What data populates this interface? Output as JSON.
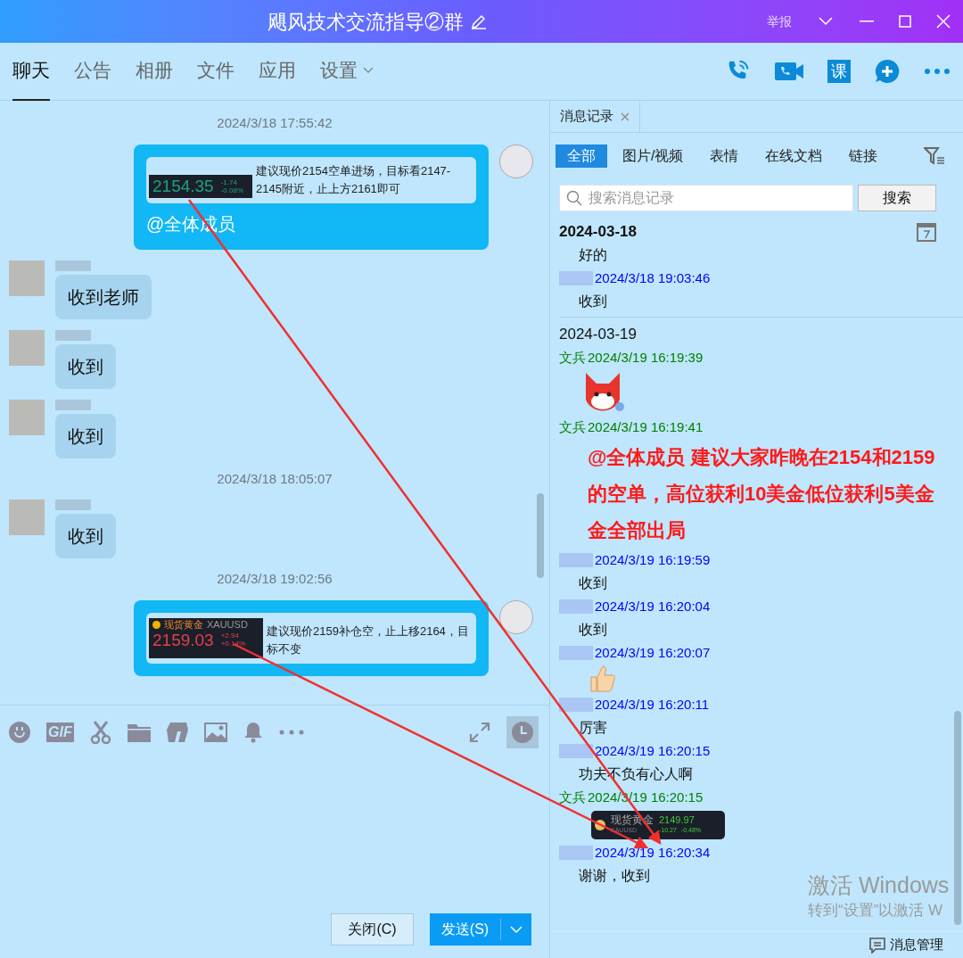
{
  "window": {
    "title": "飓风技术交流指导②群",
    "report": "举报"
  },
  "tabs": [
    {
      "label": "聊天",
      "selected": true,
      "dropdown": false
    },
    {
      "label": "公告",
      "selected": false,
      "dropdown": false
    },
    {
      "label": "相册",
      "selected": false,
      "dropdown": false
    },
    {
      "label": "文件",
      "selected": false,
      "dropdown": false
    },
    {
      "label": "应用",
      "selected": false,
      "dropdown": false
    },
    {
      "label": "设置",
      "selected": false,
      "dropdown": true
    }
  ],
  "header_actions": [
    {
      "kind": "phone"
    },
    {
      "kind": "video"
    },
    {
      "kind": "course",
      "label": "课"
    },
    {
      "kind": "add"
    },
    {
      "kind": "more"
    }
  ],
  "chat": [
    {
      "kind": "time",
      "text": "2024/3/18 17:55:42"
    },
    {
      "kind": "own",
      "quote": {
        "kind": "price",
        "price": "2154.35",
        "change": "-1.74",
        "percent": "-0.08%",
        "up": false
      },
      "text": "建议现价2154空单进场，目标看2147-2145附近，止上方2161即可",
      "mention": "@全体成员"
    },
    {
      "kind": "other",
      "text": "收到老师"
    },
    {
      "kind": "other",
      "text": "收到"
    },
    {
      "kind": "other",
      "text": "收到"
    },
    {
      "kind": "time",
      "text": "2024/3/18 18:05:07"
    },
    {
      "kind": "other",
      "text": "收到"
    },
    {
      "kind": "time",
      "text": "2024/3/18 19:02:56"
    },
    {
      "kind": "own",
      "quote": {
        "kind": "gold",
        "name": "现货黄金",
        "symbol": "XAUUSD",
        "price": "2159.03",
        "change": "+2.94",
        "percent": "+0.14%",
        "up": true
      },
      "text": "建议现价2159补仓空，止上移2164，目标不变"
    }
  ],
  "toolbar": [
    {
      "kind": "emoji"
    },
    {
      "kind": "gif",
      "label": "GIF"
    },
    {
      "kind": "scissors"
    },
    {
      "kind": "folder"
    },
    {
      "kind": "shape"
    },
    {
      "kind": "image"
    },
    {
      "kind": "bell"
    },
    {
      "kind": "more"
    }
  ],
  "buttons": {
    "close": "关闭(C)",
    "send": "发送(S)"
  },
  "history": {
    "tab": "消息记录",
    "filters": [
      {
        "label": "全部",
        "selected": true
      },
      {
        "label": "图片/视频",
        "selected": false
      },
      {
        "label": "表情",
        "selected": false
      },
      {
        "label": "在线文档",
        "selected": false
      },
      {
        "label": "链接",
        "selected": false
      }
    ],
    "search": {
      "placeholder": "搜索消息记录",
      "button": "搜索"
    },
    "entries": [
      {
        "kind": "date",
        "text": "2024-03-18",
        "bold": true
      },
      {
        "kind": "text",
        "text": "好的"
      },
      {
        "kind": "meta",
        "time": "2024/3/18 19:03:46",
        "color": "#0000ff"
      },
      {
        "kind": "text",
        "text": "收到"
      },
      {
        "kind": "date",
        "text": "2024-03-19",
        "bold": false
      },
      {
        "kind": "meta",
        "sender": "文兵",
        "time": "2024/3/19 16:19:39",
        "color": "#008000"
      },
      {
        "kind": "sticker"
      },
      {
        "kind": "meta",
        "sender": "文兵",
        "time": "2024/3/19 16:19:41",
        "color": "#008000"
      },
      {
        "kind": "alert",
        "text": "@全体成员 建议大家昨晚在2154和2159的空单，高位获利10美金低位获利5美金金全部出局"
      },
      {
        "kind": "meta",
        "time": "2024/3/19 16:19:59",
        "color": "#0000ff"
      },
      {
        "kind": "text",
        "text": "收到"
      },
      {
        "kind": "meta",
        "time": "2024/3/19 16:20:04",
        "color": "#0000ff"
      },
      {
        "kind": "text",
        "text": "收到"
      },
      {
        "kind": "meta",
        "time": "2024/3/19 16:20:07",
        "color": "#0000ff"
      },
      {
        "kind": "thumb"
      },
      {
        "kind": "meta",
        "time": "2024/3/19 16:20:11",
        "color": "#0000ff"
      },
      {
        "kind": "text",
        "text": "厉害"
      },
      {
        "kind": "meta",
        "time": "2024/3/19 16:20:15",
        "color": "#0000ff"
      },
      {
        "kind": "text",
        "text": "功夫不负有心人啊"
      },
      {
        "kind": "meta",
        "sender": "文兵",
        "time": "2024/3/19 16:20:15",
        "color": "#008000"
      },
      {
        "kind": "ticker",
        "name": "现货黄金",
        "symbol": "XAUUSD",
        "price": "2149.97",
        "change": "-10.27",
        "percent": "-0.48%"
      },
      {
        "kind": "meta",
        "time": "2024/3/19 16:20:34",
        "color": "#0000ff"
      },
      {
        "kind": "text",
        "text": "谢谢，收到"
      }
    ],
    "manage": "消息管理"
  },
  "activation": {
    "title": "激活 Windows",
    "hint": "转到“设置”以激活 W"
  }
}
